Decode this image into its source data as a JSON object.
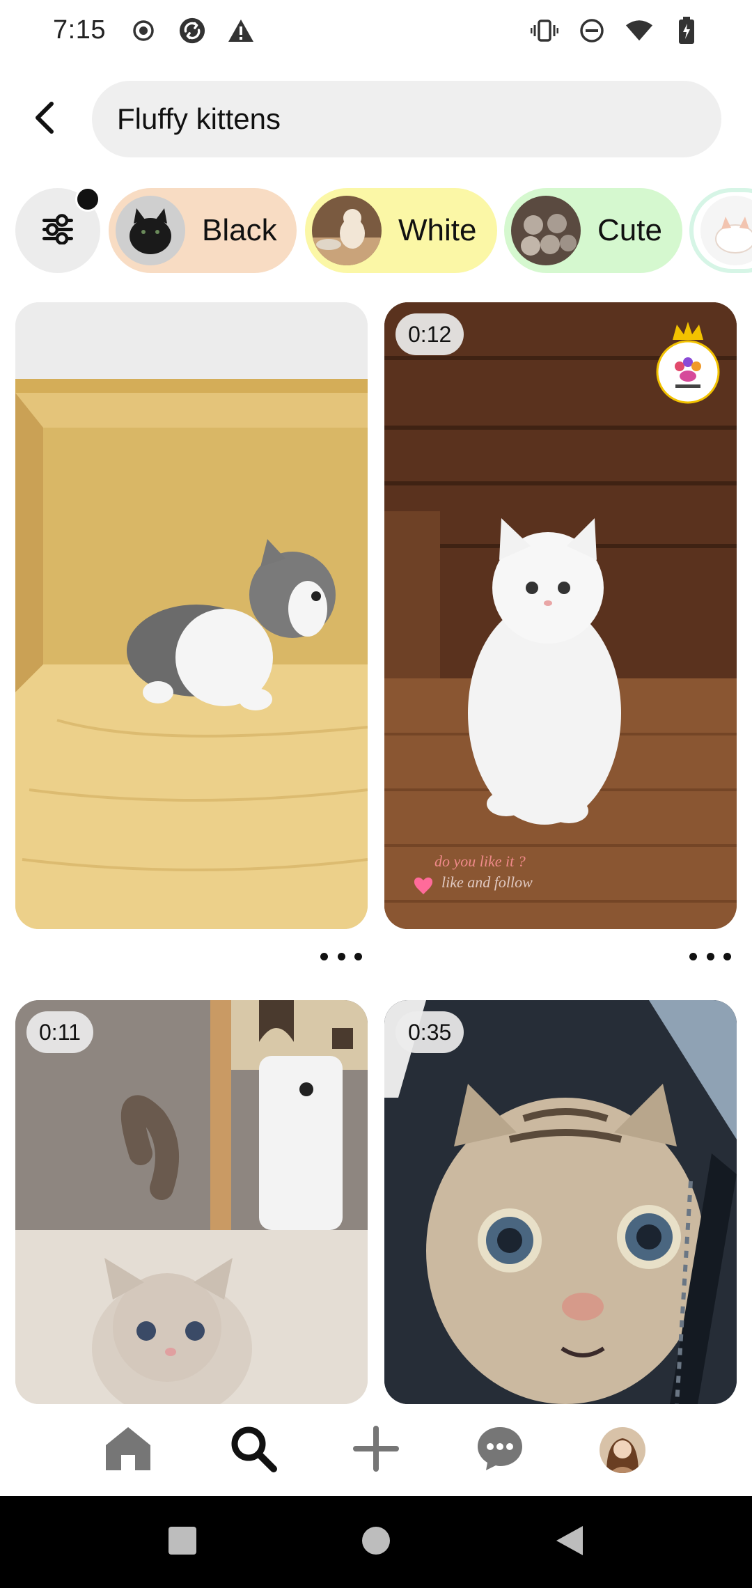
{
  "status_bar": {
    "time": "7:15",
    "left_icons": [
      "record-icon",
      "sync-icon",
      "warning-icon"
    ],
    "right_icons": [
      "vibrate-icon",
      "do-not-disturb-icon",
      "wifi-icon",
      "battery-icon"
    ]
  },
  "search": {
    "query": "Fluffy kittens"
  },
  "chips": [
    {
      "label": "Black",
      "color": "#f8dcc3"
    },
    {
      "label": "White",
      "color": "#fbf7a6"
    },
    {
      "label": "Cute",
      "color": "#d5f8cf"
    }
  ],
  "pins": [
    {
      "name": "grey-white-kitten-in-box",
      "duration": ""
    },
    {
      "name": "white-kitten-standing",
      "duration": "0:12",
      "overlay_text": "do you like it ?",
      "overlay_text_2": "like and follow"
    },
    {
      "name": "tabby-kitten-tail-up",
      "duration": "0:11"
    },
    {
      "name": "wide-eyed-tabby-cat",
      "duration": "0:35"
    }
  ],
  "bottom_nav": {
    "items": [
      "home-icon",
      "search-icon",
      "create-icon",
      "messages-icon",
      "profile-avatar"
    ],
    "active": "search-icon"
  },
  "colors": {
    "search_bg": "#efefef",
    "accent_black": "#111111"
  }
}
